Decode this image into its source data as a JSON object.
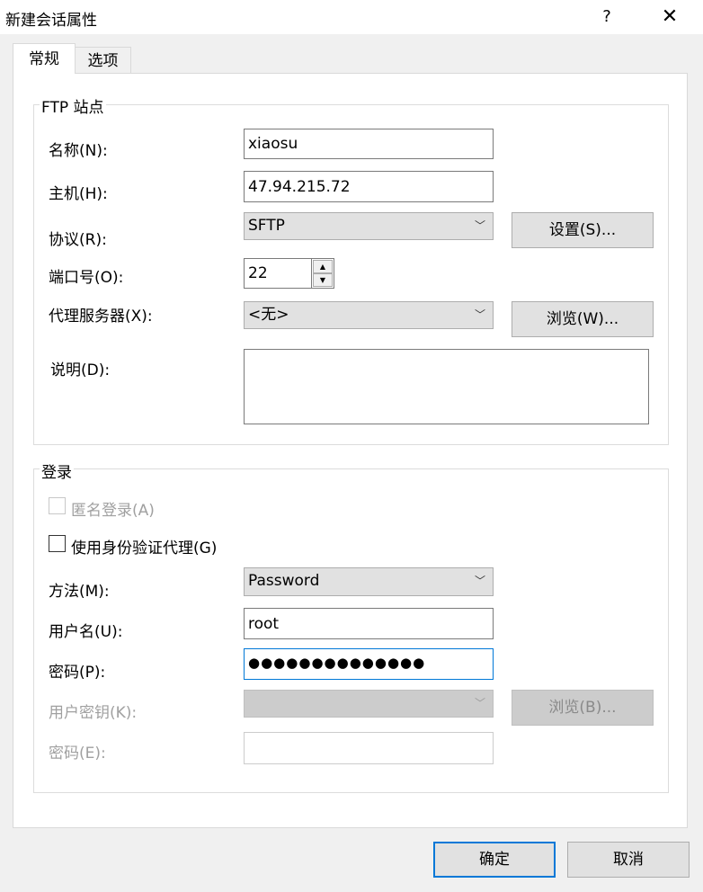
{
  "window": {
    "title": "新建会话属性",
    "help": "?",
    "close": "✕"
  },
  "tabs": [
    {
      "label": "常规",
      "active": true
    },
    {
      "label": "选项",
      "active": false
    }
  ],
  "ftp": {
    "group_title": "FTP 站点",
    "name_label": "名称(N):",
    "name_value": "xiaosu",
    "host_label": "主机(H):",
    "host_value": "47.94.215.72",
    "protocol_label": "协议(R):",
    "protocol_value": "SFTP",
    "settings_button": "设置(S)...",
    "port_label": "端口号(O):",
    "port_value": "22",
    "proxy_label": "代理服务器(X):",
    "proxy_value": "<无>",
    "browse_button": "浏览(W)...",
    "desc_label": "说明(D):",
    "desc_value": ""
  },
  "login": {
    "group_title": "登录",
    "anonymous_label": "匿名登录(A)",
    "agent_label": "使用身份验证代理(G)",
    "method_label": "方法(M):",
    "method_value": "Password",
    "user_label": "用户名(U):",
    "user_value": "root",
    "password_label": "密码(P):",
    "password_value": "●●●●●●●●●●●●●●",
    "key_label": "用户密钥(K):",
    "key_value": "",
    "key_browse_button": "浏览(B)...",
    "passphrase_label": "密码(E):",
    "passphrase_value": ""
  },
  "footer": {
    "ok_button": "确定",
    "cancel_button": "取消"
  }
}
